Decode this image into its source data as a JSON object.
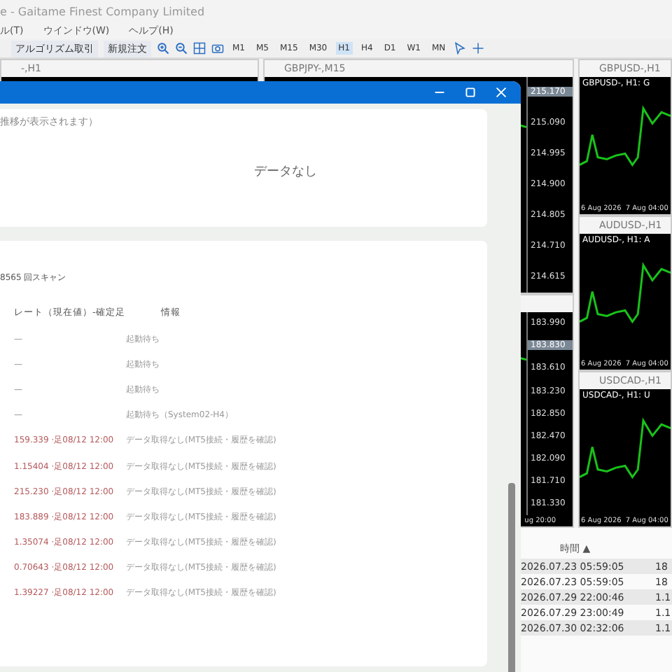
{
  "app": {
    "title": "e - Gaitame Finest Company Limited",
    "menu": [
      "ル(T)",
      "ウインドウ(W)",
      "ヘルプ(H)"
    ]
  },
  "toolbar": {
    "buttons": [
      "アルゴリズム取引",
      "新規注文"
    ],
    "timeframes": [
      {
        "label": "M1",
        "selected": false
      },
      {
        "label": "M5",
        "selected": false
      },
      {
        "label": "M15",
        "selected": false
      },
      {
        "label": "M30",
        "selected": false
      },
      {
        "label": "H1",
        "selected": true
      },
      {
        "label": "H4",
        "selected": false
      },
      {
        "label": "D1",
        "selected": false
      },
      {
        "label": "W1",
        "selected": false
      },
      {
        "label": "MN",
        "selected": false
      }
    ]
  },
  "columns": [
    {
      "charts": [
        {
          "title": "-,H1"
        }
      ]
    },
    {
      "charts": [
        {
          "title": "GBPJPY-,M15",
          "prices": [
            {
              "label": "215.170",
              "current": true
            },
            {
              "label": "215.090",
              "current": false
            },
            {
              "label": "214.995",
              "current": false
            },
            {
              "label": "214.900",
              "current": false
            },
            {
              "label": "214.805",
              "current": false
            },
            {
              "label": "214.710",
              "current": false
            },
            {
              "label": "214.615",
              "current": false
            }
          ]
        },
        {
          "prices": [
            {
              "label": "183.990",
              "current": false
            },
            {
              "label": "183.830",
              "current": true
            },
            {
              "label": "183.610",
              "current": false
            },
            {
              "label": "183.230",
              "current": false
            },
            {
              "label": "182.850",
              "current": false
            },
            {
              "label": "182.470",
              "current": false
            },
            {
              "label": "182.090",
              "current": false
            },
            {
              "label": "181.710",
              "current": false
            },
            {
              "label": "181.330",
              "current": false
            }
          ],
          "dates": [
            "ug 20:00"
          ]
        }
      ]
    },
    {
      "charts": [
        {
          "title": "GBPUSD-,H1",
          "legend": "GBPUSD-, H1: G",
          "dates": [
            "6 Aug 2026",
            "7 Aug 04:00"
          ]
        },
        {
          "title": "AUDUSD-,H1",
          "legend": "AUDUSD-, H1: A",
          "dates": [
            "6 Aug 2026",
            "7 Aug 04:00"
          ]
        },
        {
          "title": "USDCAD-,H1",
          "legend": "USDCAD-, H1: U",
          "dates": [
            "6 Aug 2026",
            "7 Aug 04:00"
          ]
        }
      ]
    }
  ],
  "terminal": {
    "sort_column": "時間 ▲",
    "rows": [
      {
        "time": "2026.07.23 05:59:05",
        "value": "18"
      },
      {
        "time": "2026.07.23 05:59:05",
        "value": "18"
      },
      {
        "time": "2026.07.29 22:00:46",
        "value": "1.1"
      },
      {
        "time": "2026.07.29 23:00:49",
        "value": "1.1"
      },
      {
        "time": "2026.07.30 02:32:06",
        "value": "1.1"
      }
    ]
  },
  "window": {
    "chart_card": {
      "caption": "推移が表示されます）",
      "empty_text": "データなし"
    },
    "scan_card": {
      "scan_count": "8565 回スキャン",
      "columns": [
        "レート（現在値）-確定足",
        "情報"
      ],
      "rows": [
        {
          "kind": "pending",
          "rate": "—",
          "info": "起動待ち"
        },
        {
          "kind": "pending",
          "rate": "—",
          "info": "起動待ち"
        },
        {
          "kind": "pending",
          "rate": "—",
          "info": "起動待ち"
        },
        {
          "kind": "pending",
          "rate": "—",
          "info": "起動待ち（System02-H4）"
        },
        {
          "kind": "error",
          "rate": "159.339 ·足08/12 12:00",
          "info": "データ取得なし(MT5接続・履歴を確認)"
        },
        {
          "kind": "error",
          "rate": "1.15404 ·足08/12 12:00",
          "info": "データ取得なし(MT5接続・履歴を確認)"
        },
        {
          "kind": "error",
          "rate": "215.230 ·足08/12 12:00",
          "info": "データ取得なし(MT5接続・履歴を確認)"
        },
        {
          "kind": "error",
          "rate": "183.889 ·足08/12 12:00",
          "info": "データ取得なし(MT5接続・履歴を確認)"
        },
        {
          "kind": "error",
          "rate": "1.35074 ·足08/12 12:00",
          "info": "データ取得なし(MT5接続・履歴を確認)"
        },
        {
          "kind": "error",
          "rate": "0.70643 ·足08/12 12:00",
          "info": "データ取得なし(MT5接続・履歴を確認)"
        },
        {
          "kind": "error",
          "rate": "1.39227 ·足08/12 12:00",
          "info": "データ取得なし(MT5接続・履歴を確認)"
        }
      ]
    }
  }
}
